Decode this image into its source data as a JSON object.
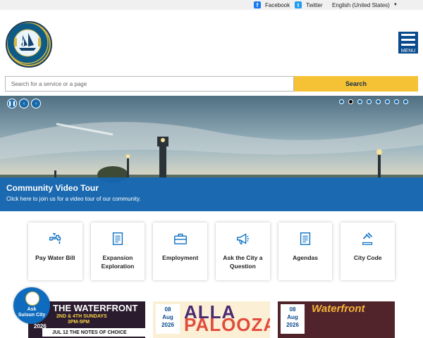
{
  "topbar": {
    "facebook_label": "Facebook",
    "twitter_label": "Twitter",
    "language_label": "English (United States)"
  },
  "logo": {
    "text": "CITY OF SUISUN CITY CALIFORNIA"
  },
  "menu": {
    "label": "MENU"
  },
  "search": {
    "placeholder": "Search for a service or a page",
    "button_label": "Search"
  },
  "hero": {
    "title": "Community Video Tour",
    "subtitle": "Click here to join us for a video tour of our community.",
    "controls": [
      "pause",
      "previous",
      "next"
    ],
    "slide_count": 8,
    "active_slide": 2
  },
  "quick_links": [
    {
      "label": "Pay Water Bill",
      "icon": "faucet-icon"
    },
    {
      "label": "Expansion Exploration",
      "icon": "document-icon"
    },
    {
      "label": "Employment",
      "icon": "briefcase-icon"
    },
    {
      "label": "Ask the City a Question",
      "icon": "megaphone-icon"
    },
    {
      "label": "Agendas",
      "icon": "document-icon"
    },
    {
      "label": "City Code",
      "icon": "gavel-icon"
    }
  ],
  "event_cards": [
    {
      "art_title": "THE WATERFRONT",
      "art_line1": "2ND & 4TH SUNDAYS",
      "art_line2": "3PM-5PM",
      "strip": "JUL 12  THE NOTES OF CHOICE",
      "year": "2026"
    },
    {
      "day": "08",
      "month": "Aug",
      "year": "2026",
      "art_line1": "ALLA",
      "art_line2": "PALOOZA"
    },
    {
      "day": "08",
      "month": "Aug",
      "year": "2026",
      "art_title": "Waterfront"
    }
  ],
  "ask_widget": {
    "line1": "Ask",
    "line2": "Suisun City"
  },
  "colors": {
    "primary_blue": "#0a4b8d",
    "search_button": "#f6c235",
    "caption_blue": "#0f69be"
  }
}
